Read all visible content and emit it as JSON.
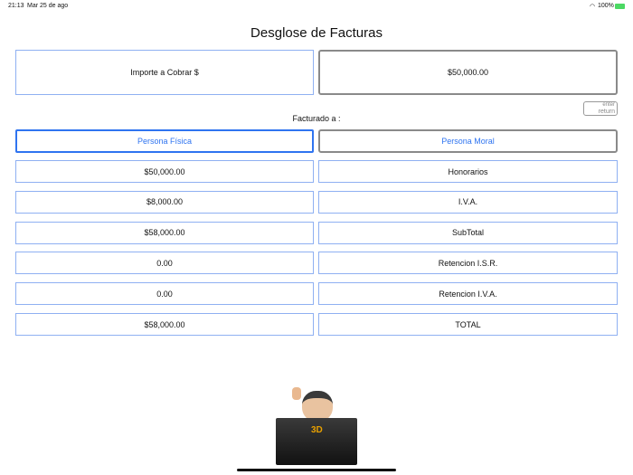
{
  "status_bar": {
    "time": "21:13",
    "date": "Mar 25 de ago",
    "battery": "100%"
  },
  "title": "Desglose de Facturas",
  "importe_label": "Importe   a   Cobrar $",
  "importe_value": "$50,000.00",
  "key": {
    "top": "enter",
    "bottom": "return"
  },
  "facturado_label": "Facturado a :",
  "persona_fisica": "Persona Física",
  "persona_moral": "Persona Moral",
  "rows": [
    {
      "value": "$50,000.00",
      "label": "Honorarios"
    },
    {
      "value": "$8,000.00",
      "label": "I.V.A."
    },
    {
      "value": "$58,000.00",
      "label": "SubTotal"
    },
    {
      "value": "0.00",
      "label": "Retencion I.S.R."
    },
    {
      "value": "0.00",
      "label": "Retencion I.V.A."
    },
    {
      "value": "$58,000.00",
      "label": "TOTAL"
    }
  ]
}
